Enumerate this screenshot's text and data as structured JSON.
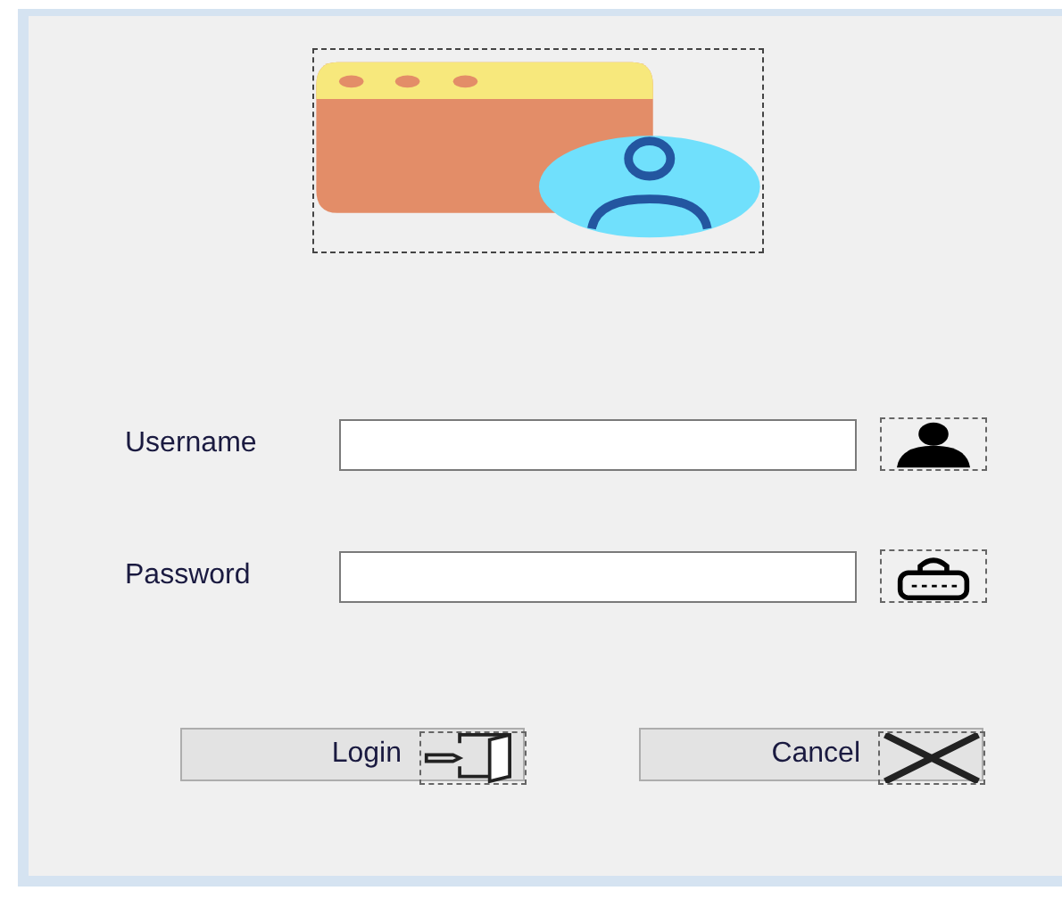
{
  "fields": [
    {
      "label": "Username",
      "kind": "user"
    },
    {
      "label": "Password",
      "kind": "lock"
    }
  ],
  "buttons": [
    {
      "label": "Login",
      "kind": "door"
    },
    {
      "label": "Cancel",
      "kind": "cross"
    }
  ]
}
